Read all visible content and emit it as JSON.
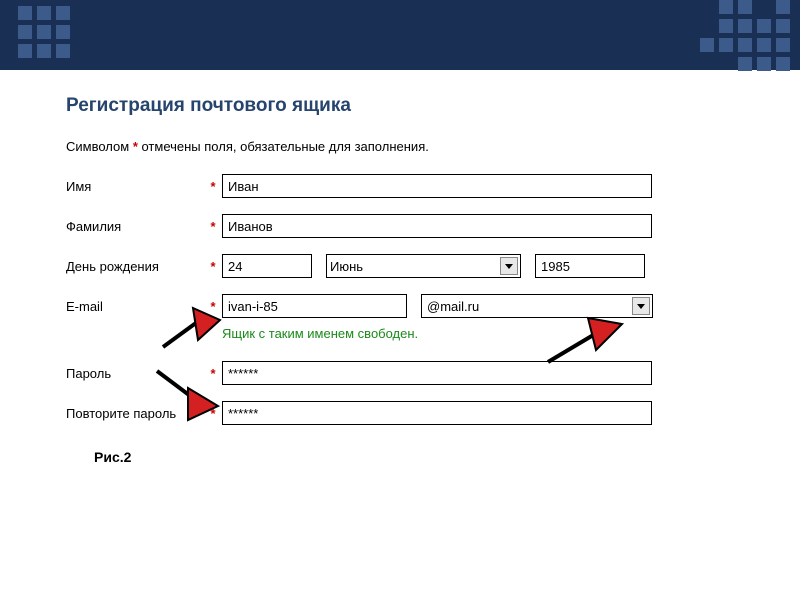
{
  "page": {
    "title": "Регистрация почтового ящика",
    "note_prefix": "Символом ",
    "note_symbol": "*",
    "note_suffix": " отмечены поля, обязательные для заполнения.",
    "figure_label": "Рис.2"
  },
  "form": {
    "required_mark": "*",
    "first_name": {
      "label": "Имя",
      "value": "Иван"
    },
    "last_name": {
      "label": "Фамилия",
      "value": "Иванов"
    },
    "birthday": {
      "label": "День рождения",
      "day": "24",
      "month": "Июнь",
      "year": "1985"
    },
    "email": {
      "label": "E-mail",
      "value": "ivan-i-85",
      "domain": "@mail.ru",
      "status": "Ящик с таким именем свободен."
    },
    "password": {
      "label": "Пароль",
      "value": "******"
    },
    "password_confirm": {
      "label": "Повторите пароль",
      "value": "******"
    }
  }
}
